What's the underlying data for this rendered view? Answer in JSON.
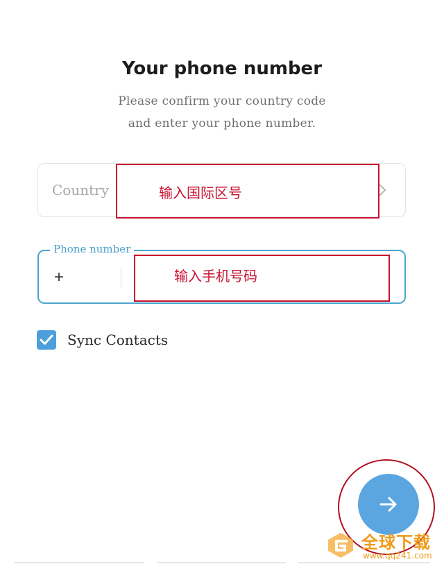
{
  "header": {
    "title": "Your phone number",
    "subtitle_line1": "Please confirm your country code",
    "subtitle_line2": "and enter your phone number."
  },
  "country_field": {
    "placeholder": "Country",
    "annotation": "输入国际区号"
  },
  "phone_field": {
    "label": "Phone number",
    "prefix": "+",
    "annotation": "输入手机号码"
  },
  "sync": {
    "label": "Sync Contacts",
    "checked": true
  },
  "next_button": {
    "icon": "arrow-right-icon"
  },
  "watermark": {
    "title": "全球下载",
    "url": "www.qq241.com"
  },
  "colors": {
    "accent": "#5ba6e0",
    "field_border": "#4aa5cf",
    "annotation": "#c8102e",
    "watermark": "#f19a1b"
  }
}
